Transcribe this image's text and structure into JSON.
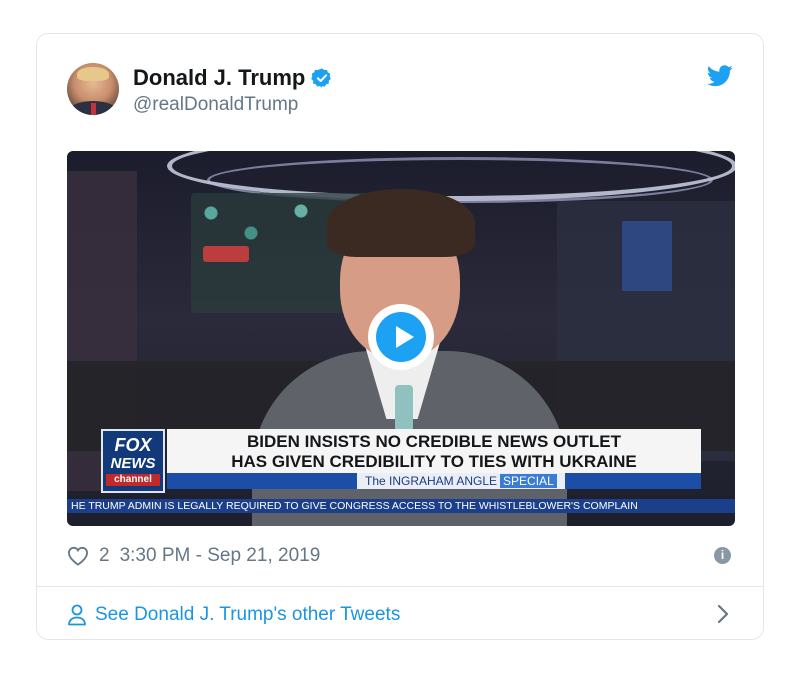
{
  "tweet": {
    "author_name": "Donald J. Trump",
    "handle": "@realDonaldTrump",
    "likes": "2",
    "timestamp": "3:30 PM - Sep 21, 2019",
    "footer_link": "See Donald J. Trump's other Tweets"
  },
  "media": {
    "network_logo_line1": "FOX",
    "network_logo_line2": "NEWS",
    "network_logo_line3": "channel",
    "headline_line1": "BIDEN INSISTS NO CREDIBLE NEWS OUTLET",
    "headline_line2": "HAS GIVEN CREDIBILITY TO TIES WITH UKRAINE",
    "show_name": "The INGRAHAM ANGLE",
    "show_tag": "SPECIAL",
    "ticker": "HE TRUMP ADMIN IS LEGALLY REQUIRED TO GIVE CONGRESS ACCESS TO THE WHISTLEBLOWER'S COMPLAIN"
  },
  "icons": {
    "verified": "verified-badge-icon",
    "bird": "twitter-bird-icon",
    "play": "play-icon",
    "heart": "heart-icon",
    "info": "info-icon",
    "person": "person-icon",
    "chevron": "chevron-right-icon"
  },
  "colors": {
    "accent": "#1da1f2",
    "link": "#1b95e0",
    "muted": "#657786",
    "border": "#e1e8ed"
  }
}
